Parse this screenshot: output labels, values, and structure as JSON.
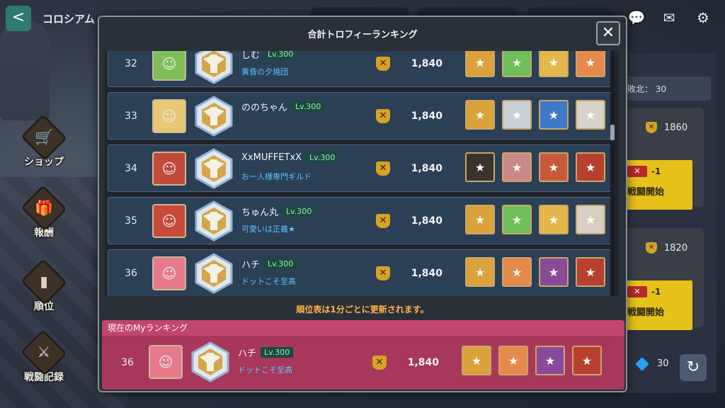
{
  "header": {
    "title": "コロシアム",
    "back_label": "<"
  },
  "nav": [
    {
      "label": "ショップ",
      "icon": "cart-icon"
    },
    {
      "label": "報酬",
      "icon": "gift-icon"
    },
    {
      "label": "順位",
      "icon": "podium-icon"
    },
    {
      "label": "戦闘記録",
      "icon": "battle-record-icon"
    }
  ],
  "right_panel": {
    "strip_text": "敗北： 30",
    "opponents": [
      {
        "score": "1860",
        "cost": "-1",
        "button": "戦闘開始"
      },
      {
        "score": "1820",
        "cost": "-1",
        "button": "戦闘開始"
      }
    ],
    "gems": "30"
  },
  "modal": {
    "title": "合計トロフィーランキング",
    "close": "✕",
    "update_note": "順位表は1分ごとに更新されます。",
    "my_header": "現在のMyランキング"
  },
  "rows": [
    {
      "rank": "32",
      "name": "しむ",
      "level": "Lv.300",
      "guild": "黄昏の夕焼団",
      "score": "1,840"
    },
    {
      "rank": "33",
      "name": "ののちゃん",
      "level": "Lv.300",
      "guild": "",
      "score": "1,840"
    },
    {
      "rank": "34",
      "name": "XxMUFFETxX",
      "level": "Lv.300",
      "guild": "お一人様専門ギルド",
      "score": "1,840"
    },
    {
      "rank": "35",
      "name": "ちゅん丸",
      "level": "Lv.300",
      "guild": "可愛いは正義★",
      "score": "1,840"
    },
    {
      "rank": "36",
      "name": "ハチ",
      "level": "Lv.300",
      "guild": "ドットこそ至高",
      "score": "1,840"
    }
  ],
  "my_rank": {
    "rank": "36",
    "name": "ハチ",
    "level": "Lv.300",
    "guild": "ドットこそ至高",
    "score": "1,840"
  },
  "colors": {
    "row_bg": "#2b3f55",
    "my_bg": "#a8375c",
    "level_text": "#9fe4c7",
    "guild_text": "#59c5ff",
    "note_text": "#ffb347"
  }
}
